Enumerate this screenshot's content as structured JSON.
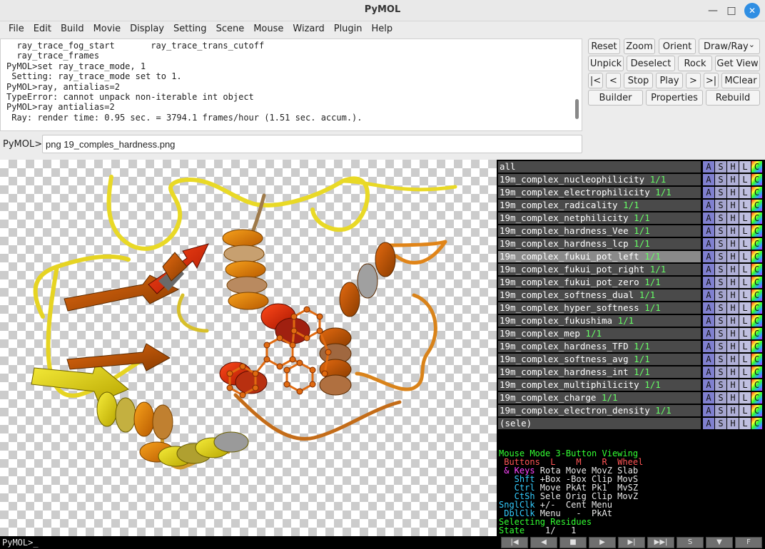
{
  "window": {
    "title": "PyMOL"
  },
  "menu": [
    "File",
    "Edit",
    "Build",
    "Movie",
    "Display",
    "Setting",
    "Scene",
    "Mouse",
    "Wizard",
    "Plugin",
    "Help"
  ],
  "console_lines": [
    "  ray_trace_fog_start       ray_trace_trans_cutoff",
    "  ray_trace_frames",
    "PyMOL>set ray_trace_mode, 1",
    " Setting: ray_trace_mode set to 1.",
    "PyMOL>ray, antialias=2",
    "TypeError: cannot unpack non-iterable int object",
    "PyMOL>ray antialias=2",
    " Ray: render time: 0.95 sec. = 3794.1 frames/hour (1.51 sec. accum.)."
  ],
  "command": {
    "prompt": "PyMOL>",
    "value": "png 19_comples_hardness.png"
  },
  "buttons": {
    "reset": "Reset",
    "zoom": "Zoom",
    "orient": "Orient",
    "draw_ray": "Draw/Ray",
    "unpick": "Unpick",
    "deselect": "Deselect",
    "rock": "Rock",
    "get_view": "Get View",
    "first": "|<",
    "prev": "<",
    "stop": "Stop",
    "play": "Play",
    "next": ">",
    "last": ">|",
    "mclear": "MClear",
    "builder": "Builder",
    "properties": "Properties",
    "rebuild": "Rebuild"
  },
  "objects": [
    {
      "name": "all",
      "state": "",
      "selected": false
    },
    {
      "name": "19m_complex_nucleophilicity",
      "state": "1/1",
      "selected": false
    },
    {
      "name": "19m_complex_electrophilicity",
      "state": "1/1",
      "selected": false
    },
    {
      "name": "19m_complex_radicality",
      "state": "1/1",
      "selected": false
    },
    {
      "name": "19m_complex_netphilicity",
      "state": "1/1",
      "selected": false
    },
    {
      "name": "19m_complex_hardness_Vee",
      "state": "1/1",
      "selected": false
    },
    {
      "name": "19m_complex_hardness_lcp",
      "state": "1/1",
      "selected": false
    },
    {
      "name": "19m_complex_fukui_pot_left",
      "state": "1/1",
      "selected": true
    },
    {
      "name": "19m_complex_fukui_pot_right",
      "state": "1/1",
      "selected": false
    },
    {
      "name": "19m_complex_fukui_pot_zero",
      "state": "1/1",
      "selected": false
    },
    {
      "name": "19m_complex_softness_dual",
      "state": "1/1",
      "selected": false
    },
    {
      "name": "19m_complex_hyper_softness",
      "state": "1/1",
      "selected": false
    },
    {
      "name": "19m_complex_fukushima",
      "state": "1/1",
      "selected": false
    },
    {
      "name": "19m_complex_mep",
      "state": "1/1",
      "selected": false
    },
    {
      "name": "19m_complex_hardness_TFD",
      "state": "1/1",
      "selected": false
    },
    {
      "name": "19m_complex_softness_avg",
      "state": "1/1",
      "selected": false
    },
    {
      "name": "19m_complex_hardness_int",
      "state": "1/1",
      "selected": false
    },
    {
      "name": "19m_complex_multiphilicity",
      "state": "1/1",
      "selected": false
    },
    {
      "name": "19m_complex_charge",
      "state": "1/1",
      "selected": false
    },
    {
      "name": "19m_complex_electron_density",
      "state": "1/1",
      "selected": false
    },
    {
      "name": "(sele)",
      "state": "",
      "selected": false
    }
  ],
  "object_buttons": [
    "A",
    "S",
    "H",
    "L",
    "C"
  ],
  "mouse_panel": {
    "mode_line": "Mouse Mode 3-Button Viewing",
    "buttons_line": " Buttons  L    M    R  Wheel",
    "keys_label": " & Keys",
    "keys_vals": " Rota Move MovZ Slab",
    "shft_label": "   Shft",
    "shft_vals": " +Box -Box Clip MovS",
    "ctrl_label": "   Ctrl",
    "ctrl_vals": " Move PkAt Pk1  MvSZ",
    "ctsh_label": "   CtSh",
    "ctsh_vals": " Sele Orig Clip MovZ",
    "sngl_label": "SnglClk",
    "sngl_vals": " +/-  Cent Menu",
    "dbl_label": " DblClk",
    "dbl_vals": " Menu   -  PkAt",
    "selecting": "Selecting Residues",
    "state_label": "State",
    "state_vals": "    1/   1"
  },
  "movie_controls": [
    "|◀",
    "◀",
    "■",
    "▶",
    "▶|",
    "▶▶|",
    "S",
    "▼",
    "F"
  ],
  "bottom_prompt": "PyMOL>_",
  "colors": {
    "accent_close": "#2f8ee3",
    "panel_bg": "#000000",
    "object_row": "#4a4a4a",
    "object_selected": "#8a8a8a",
    "state_green": "#66ff66"
  },
  "icons": {
    "minimize": "minimize-icon",
    "maximize": "maximize-icon",
    "close": "close-icon",
    "dropdown": "chevron-down-icon"
  }
}
